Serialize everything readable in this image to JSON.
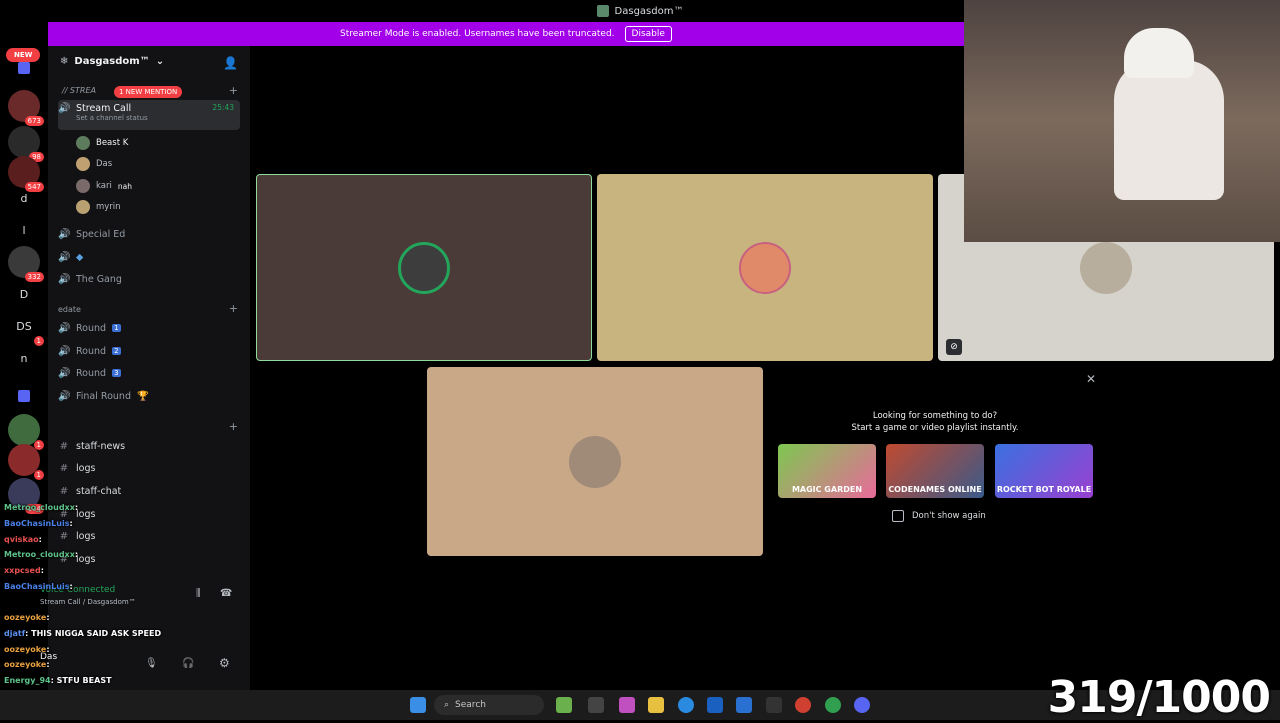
{
  "window": {
    "title": "Dasgasdom™"
  },
  "banner": {
    "text": "Streamer Mode is enabled. Usernames have been truncated.",
    "disable_label": "Disable"
  },
  "rail": {
    "new_label": "NEW",
    "items": [
      {
        "label": "",
        "badge": ""
      },
      {
        "label": "",
        "badge": "673"
      },
      {
        "label": "",
        "badge": "98"
      },
      {
        "label": "",
        "badge": "547"
      },
      {
        "label": "d",
        "badge": ""
      },
      {
        "label": "l",
        "badge": ""
      },
      {
        "label": "",
        "badge": "332"
      },
      {
        "label": "D",
        "badge": ""
      },
      {
        "label": "DS",
        "badge": "1"
      },
      {
        "label": "n",
        "badge": ""
      },
      {
        "label": "",
        "badge": ""
      },
      {
        "label": "",
        "badge": "1"
      },
      {
        "label": "",
        "badge": "1"
      },
      {
        "label": "",
        "badge": "134"
      }
    ]
  },
  "sidebar": {
    "server_name": "Dasgasdom™",
    "mention_pill": "1 NEW MENTION",
    "category_stream": "// STREA",
    "active_channel": {
      "name": "Stream Call",
      "status": "Set a channel status",
      "timer": "25:43"
    },
    "members": [
      {
        "name": "Beast K",
        "tag": ""
      },
      {
        "name": "Das",
        "tag": ""
      },
      {
        "name": "kari",
        "tag": "nah"
      },
      {
        "name": "myrin",
        "tag": ""
      }
    ],
    "voice_channels": [
      {
        "name": "Special Ed"
      },
      {
        "name": ""
      },
      {
        "name": "The Gang"
      }
    ],
    "category_edate": "edate",
    "rounds": [
      {
        "name": "Round",
        "num": "1"
      },
      {
        "name": "Round",
        "num": "2"
      },
      {
        "name": "Round",
        "num": "3"
      },
      {
        "name": "Final Round",
        "num": "🏆"
      }
    ],
    "text_channels": [
      "staff-news",
      "logs",
      "staff-chat",
      "logs",
      "logs",
      "logs"
    ]
  },
  "voice_panel": {
    "status": "Voice Connected",
    "location": "Stream Call / Dasgasdom™",
    "user": "Das"
  },
  "activity": {
    "title_line1": "Looking for something to do?",
    "title_line2": "Start a game or video playlist instantly.",
    "games": [
      "MAGIC GARDEN",
      "CODENAMES ONLINE",
      "ROCKET BOT ROYALE"
    ],
    "dont_show": "Don't show again"
  },
  "chat": [
    {
      "user": "Metroo_cloudxx",
      "msg": ":"
    },
    {
      "user": "BaoChasinLuis",
      "msg": ":"
    },
    {
      "user": "qviskao",
      "msg": ":"
    },
    {
      "user": "Metroo_cloudxx",
      "msg": ":"
    },
    {
      "user": "xxpcsed",
      "msg": ":"
    },
    {
      "user": "BaoChasinLuis",
      "msg": ":"
    },
    {
      "user": "oozeyoke",
      "msg": ":"
    },
    {
      "user": "djatf",
      "msg": ": THIS NIGGA SAID ASK SPEED"
    },
    {
      "user": "oozeyoke",
      "msg": ":"
    },
    {
      "user": "oozeyoke",
      "msg": ":"
    },
    {
      "user": "Energy_94",
      "msg": ": STFU BEAST"
    }
  ],
  "taskbar": {
    "search_placeholder": "Search"
  },
  "counter": "319/1000",
  "colors": {
    "banner": "#a100e8",
    "tile_brown": "#4a3a38",
    "tile_tan": "#c8b47e",
    "tile_gray": "#d6d2cc",
    "tile_beige": "#c9a888"
  }
}
